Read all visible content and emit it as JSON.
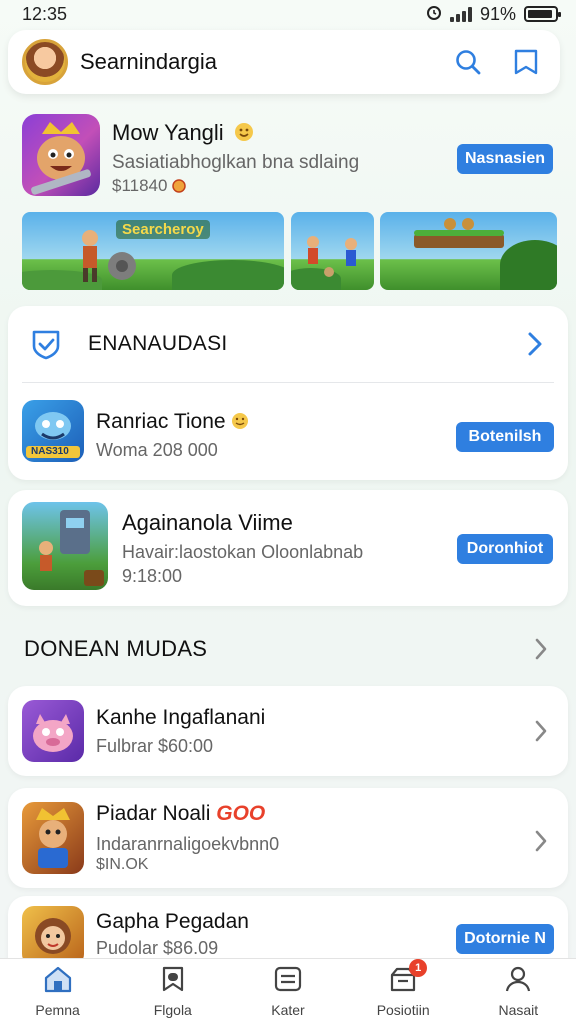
{
  "status_bar": {
    "time": "12:35",
    "battery": "91%",
    "battery_level": 0.91
  },
  "header": {
    "title": "Searnindargia"
  },
  "featured": {
    "title": "Mow Yangli",
    "subtitle": "Sasiatiabhoglkan bna sdlaing",
    "price": "$11840",
    "button": "Nasnasien",
    "banner_text": "Searcheroy"
  },
  "section1": {
    "title": "ENANAUDASI",
    "apps": [
      {
        "title": "Ranriac Tione",
        "subtitle": "Woma 208 000",
        "icon_text": "NAS310",
        "button": "Botenilsh"
      }
    ]
  },
  "card2": {
    "title": "Againanola Viime",
    "subtitle": "Havair:laostokan Oloonlabnab",
    "price": "9:18:00",
    "button": "Doronhiot"
  },
  "section2": {
    "title": "DONEAN MUDAS",
    "apps": [
      {
        "title": "Kanhe Ingaflanani",
        "subtitle": "Fulbrar $60:00"
      },
      {
        "title": "Piadar Noali",
        "title_badge": "GOO",
        "subtitle": "Indaranrnaligoekvbnn0",
        "subtitle2": "$IN.OK"
      },
      {
        "title": "Gapha Pegadan",
        "subtitle": "Pudolar $86.09",
        "button": "Dotornie N"
      }
    ]
  },
  "bottom_nav": [
    {
      "label": "Pemna",
      "icon": "home-icon"
    },
    {
      "label": "Flgola",
      "icon": "bookmark-icon"
    },
    {
      "label": "Kater",
      "icon": "list-icon"
    },
    {
      "label": "Posiotiin",
      "icon": "inbox-icon",
      "badge": "1"
    },
    {
      "label": "Nasait",
      "icon": "profile-icon"
    }
  ],
  "colors": {
    "accent": "#2f7fe0",
    "badge": "#e8412b"
  }
}
